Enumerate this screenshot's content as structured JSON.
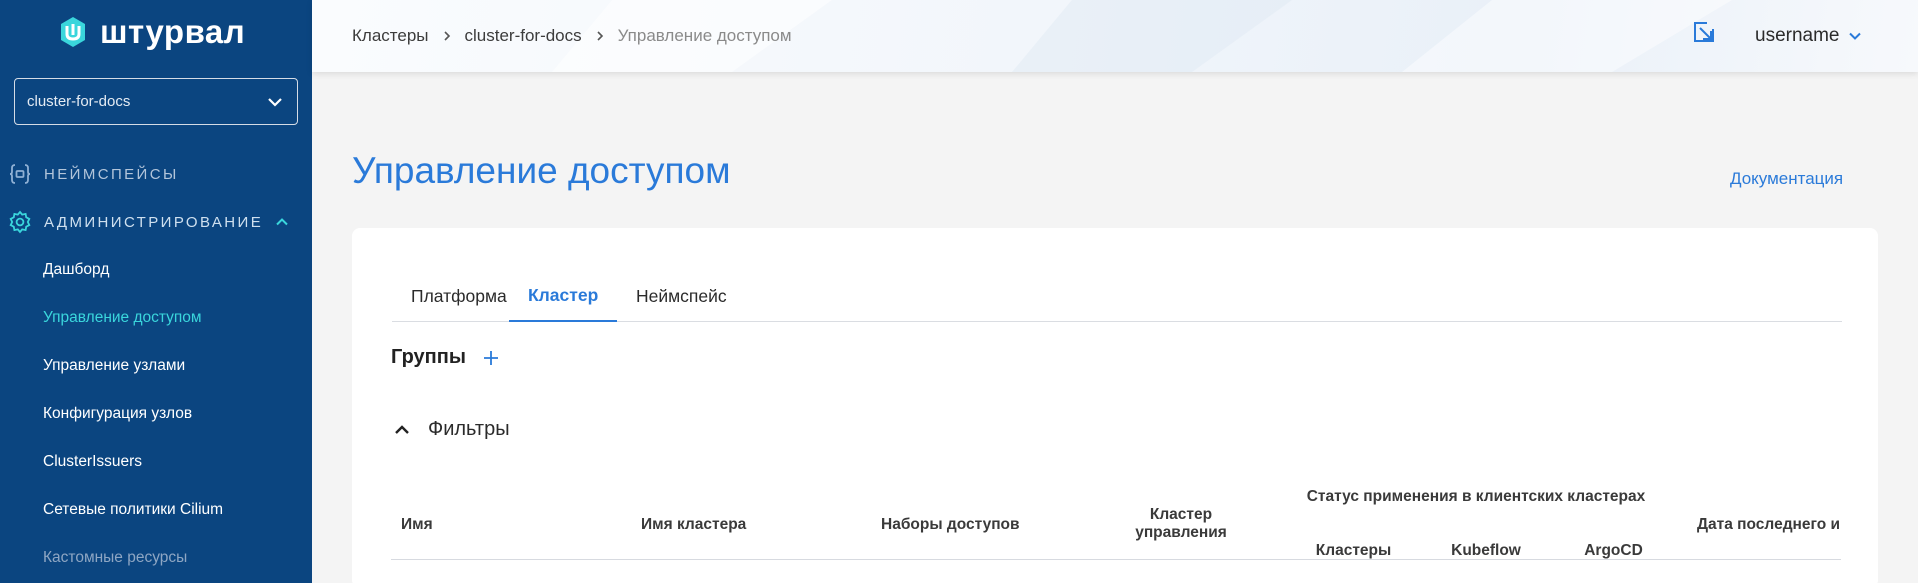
{
  "sidebar": {
    "logo_text": "штурвал",
    "cluster_select": {
      "value": "cluster-for-docs"
    },
    "sections": [
      {
        "label": "НЕЙМСПЕЙСЫ",
        "icon": "braces-icon"
      },
      {
        "label": "АДМИНИСТРИРОВАНИЕ",
        "icon": "gear-icon",
        "expanded": true
      }
    ],
    "items": [
      {
        "label": "Дашборд"
      },
      {
        "label": "Управление доступом",
        "active": true
      },
      {
        "label": "Управление узлами"
      },
      {
        "label": "Конфигурация узлов"
      },
      {
        "label": "ClusterIssuers"
      },
      {
        "label": "Сетевые политики Cilium"
      },
      {
        "label": "Кастомные ресурсы"
      }
    ]
  },
  "header": {
    "breadcrumb": [
      "Кластеры",
      "cluster-for-docs",
      "Управление доступом"
    ],
    "user": "username"
  },
  "page": {
    "title": "Управление доступом",
    "doc_link": "Документация"
  },
  "tabs": [
    {
      "label": "Платформа"
    },
    {
      "label": "Кластер",
      "active": true
    },
    {
      "label": "Неймспейс"
    }
  ],
  "groups": {
    "title": "Группы"
  },
  "filters": {
    "label": "Фильтры"
  },
  "table": {
    "columns": {
      "name": "Имя",
      "cluster_name": "Имя кластера",
      "access_sets": "Наборы доступов",
      "management_cluster": "Кластер управления",
      "status_group": "Статус применения в клиентских кластерах",
      "status_clusters": "Кластеры",
      "status_kubeflow": "Kubeflow",
      "status_argocd": "ArgoCD",
      "last_date": "Дата последнего и"
    }
  },
  "colors": {
    "sidebar_bg": "#0b4580",
    "accent": "#2a7ad9",
    "active_nav": "#3ad6dc"
  }
}
